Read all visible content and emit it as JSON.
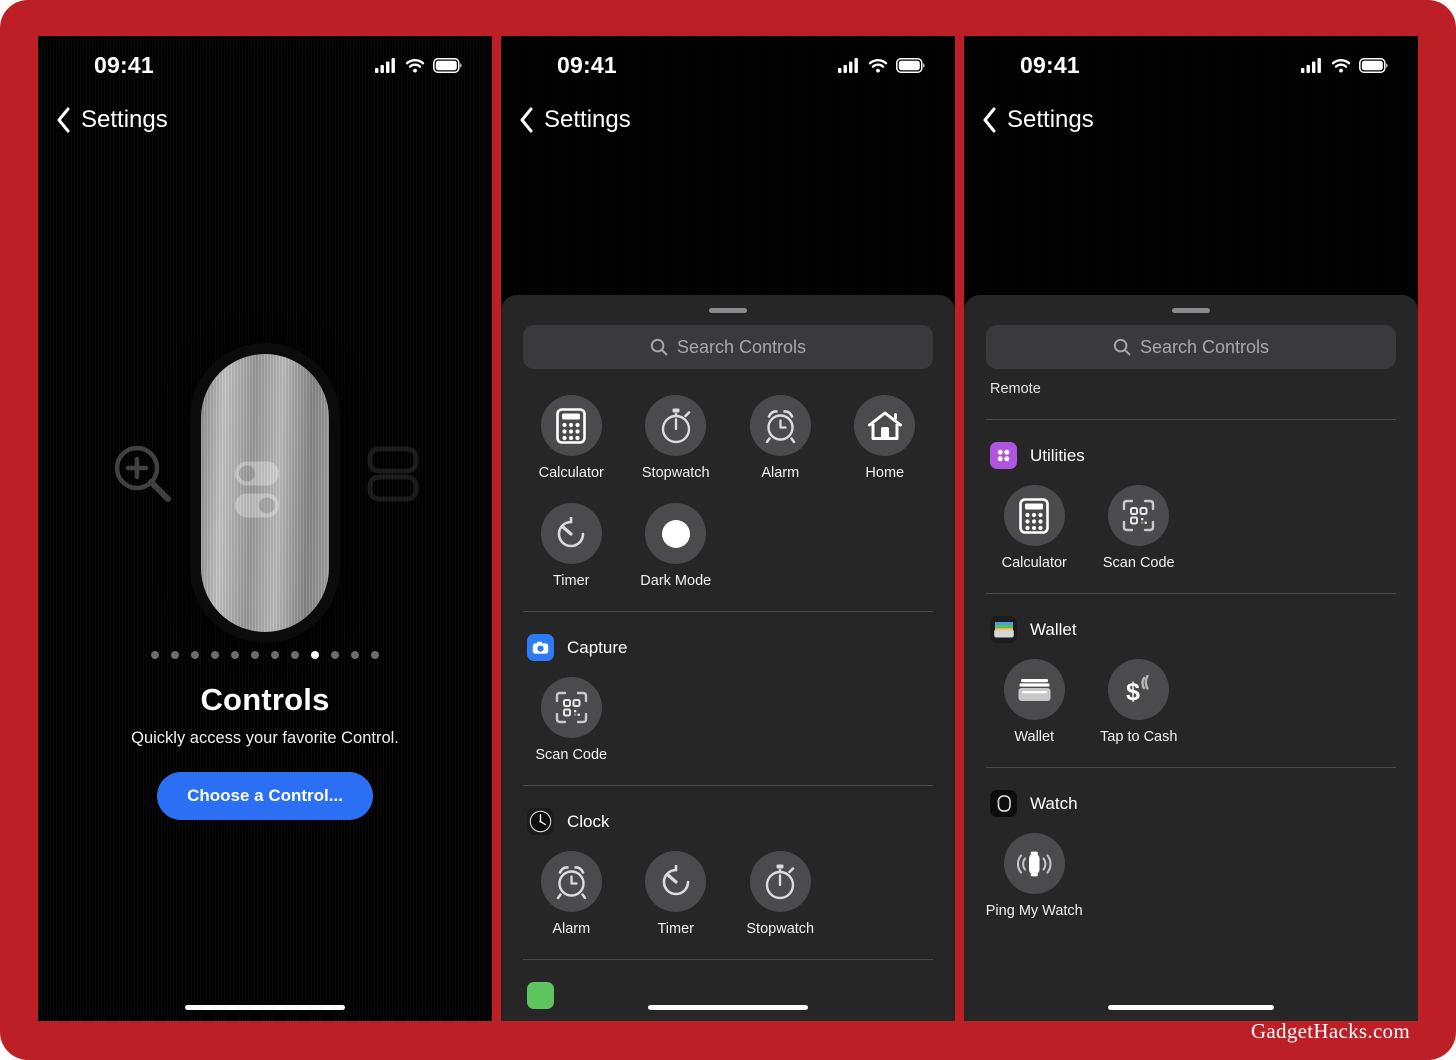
{
  "watermark": "GadgetHacks.com",
  "theme": {
    "frame_red": "#bc1f26",
    "accent_blue": "#2b6ff5",
    "sheet_bg": "#262626",
    "bubble_bg": "#4b4b4d",
    "search_bg": "#3a3a3c"
  },
  "statusbar": {
    "time": "09:41",
    "icons": [
      "cellular-signal-icon",
      "wifi-icon",
      "battery-icon"
    ]
  },
  "navbar": {
    "back_label": "Settings",
    "back_icon": "chevron-left-icon"
  },
  "panel1": {
    "hero": {
      "capsule_icon": "toggles-icon",
      "left_icon": "magnifier-plus-icon",
      "right_icon": "shortcuts-layers-icon",
      "title": "Controls",
      "subtitle": "Quickly access your favorite Control.",
      "button_label": "Choose a Control...",
      "dots_total": 12,
      "dot_active_index": 8
    }
  },
  "panel2": {
    "search_placeholder": "Search Controls",
    "top_grid": [
      {
        "label": "Calculator",
        "icon": "calculator-icon"
      },
      {
        "label": "Stopwatch",
        "icon": "stopwatch-icon"
      },
      {
        "label": "Alarm",
        "icon": "alarm-clock-icon"
      },
      {
        "label": "Home",
        "icon": "house-icon"
      },
      {
        "label": "Timer",
        "icon": "timer-icon"
      },
      {
        "label": "Dark Mode",
        "icon": "dark-mode-icon"
      }
    ],
    "sections": [
      {
        "title": "Capture",
        "app_icon": "camera-app-icon",
        "app_color": "#2b7cf6",
        "items": [
          {
            "label": "Scan Code",
            "icon": "qr-scan-icon"
          }
        ]
      },
      {
        "title": "Clock",
        "app_icon": "clock-app-icon",
        "app_color": "#1c1c1e",
        "items": [
          {
            "label": "Alarm",
            "icon": "alarm-clock-icon"
          },
          {
            "label": "Timer",
            "icon": "timer-icon"
          },
          {
            "label": "Stopwatch",
            "icon": "stopwatch-icon"
          }
        ]
      },
      {
        "title": "",
        "app_icon": "connectivity-app-icon",
        "app_color": "#5ec45e",
        "items": []
      }
    ]
  },
  "panel3": {
    "search_placeholder": "Search Controls",
    "cut_label": "Remote",
    "sections": [
      {
        "title": "Utilities",
        "app_icon": "utilities-app-icon",
        "app_color": "#b055e0",
        "items": [
          {
            "label": "Calculator",
            "icon": "calculator-icon"
          },
          {
            "label": "Scan Code",
            "icon": "qr-scan-icon"
          }
        ]
      },
      {
        "title": "Wallet",
        "app_icon": "wallet-app-icon",
        "app_color": "#1c1c1e",
        "items": [
          {
            "label": "Wallet",
            "icon": "wallet-card-icon"
          },
          {
            "label": "Tap to Cash",
            "icon": "dollar-contactless-icon"
          }
        ]
      },
      {
        "title": "Watch",
        "app_icon": "watch-app-icon",
        "app_color": "#1c1c1e",
        "items": [
          {
            "label": "Ping My Watch",
            "icon": "ping-watch-icon"
          }
        ]
      }
    ]
  }
}
